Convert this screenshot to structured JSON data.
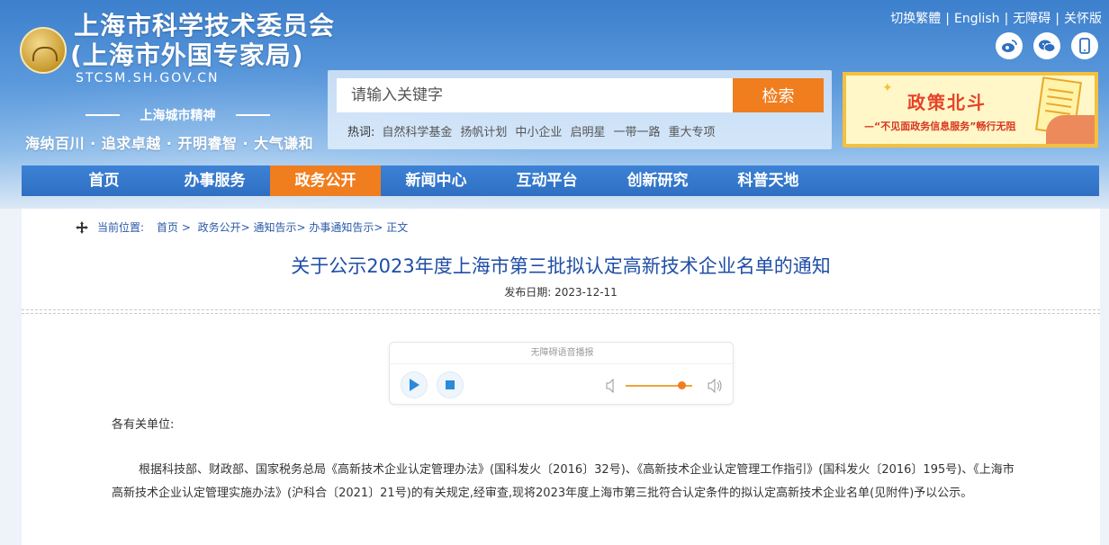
{
  "header": {
    "title": "上海市科学技术委员会",
    "subtitle": "(上海市外国专家局)",
    "domain": "STCSM.SH.GOV.CN",
    "spirit_label": "上海城市精神",
    "spirit_slogan": "海纳百川 · 追求卓越 · 开明睿智 · 大气谦和"
  },
  "top_links": [
    "切换繁體",
    "English",
    "无障碍",
    "关怀版"
  ],
  "social_icons": [
    "weibo-icon",
    "wechat-icon",
    "mobile-icon"
  ],
  "search": {
    "placeholder": "请输入关键字",
    "button_label": "检索",
    "hot_label": "热词:",
    "hot_words": [
      "自然科学基金",
      "扬帆计划",
      "中小企业",
      "启明星",
      "一带一路",
      "重大专项"
    ]
  },
  "banner": {
    "title": "政策北斗",
    "subtitle": "—“不见面政务信息服务”畅行无阻"
  },
  "nav": {
    "items": [
      "首页",
      "办事服务",
      "政务公开",
      "新闻中心",
      "互动平台",
      "创新研究",
      "科普天地"
    ],
    "active_index": 2
  },
  "breadcrumb": {
    "label": "当前位置:",
    "items": [
      "首页",
      "政务公开",
      "通知告示",
      "办事通知告示",
      "正文"
    ]
  },
  "article": {
    "title": "关于公示2023年度上海市第三批拟认定高新技术企业名单的通知",
    "date_label": "发布日期:",
    "date": "2023-12-11",
    "greeting": "各有关单位:",
    "body": "根据科技部、财政部、国家税务总局《高新技术企业认定管理办法》(国科发火〔2016〕32号)、《高新技术企业认定管理工作指引》(国科发火〔2016〕195号)、《上海市高新技术企业认定管理实施办法》(沪科合〔2021〕21号)的有关规定,经审查,现将2023年度上海市第三批符合认定条件的拟认定高新技术企业名单(见附件)予以公示。"
  },
  "player": {
    "title": "无障碍语音播报",
    "volume_fraction": 0.8
  },
  "colors": {
    "brand_blue": "#2f6fc2",
    "accent_orange": "#f07d1e",
    "title_blue": "#1f4ea6"
  }
}
